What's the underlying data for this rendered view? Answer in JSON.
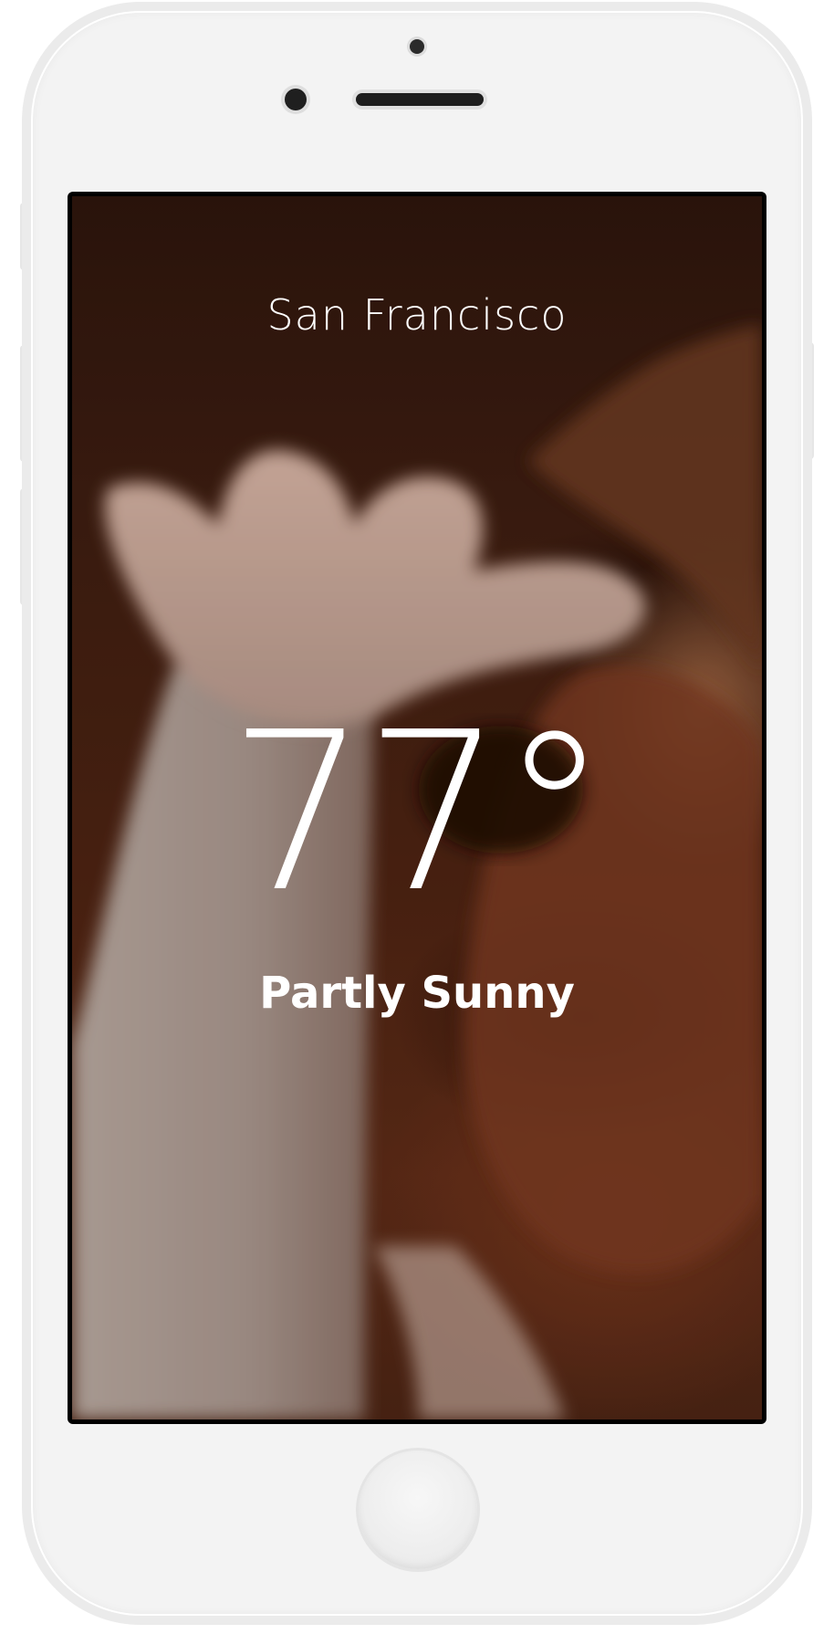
{
  "weather": {
    "city": "San Francisco",
    "temperature": "77°",
    "condition": "Partly Sunny"
  },
  "colors": {
    "device_body": "#f3f3f3",
    "screen_text": "#ffffff",
    "backdrop_tone": "#4a2212"
  },
  "icons": {
    "home_button": "home-button",
    "front_camera": "front-camera-icon",
    "speaker": "earpiece-speaker-icon"
  }
}
